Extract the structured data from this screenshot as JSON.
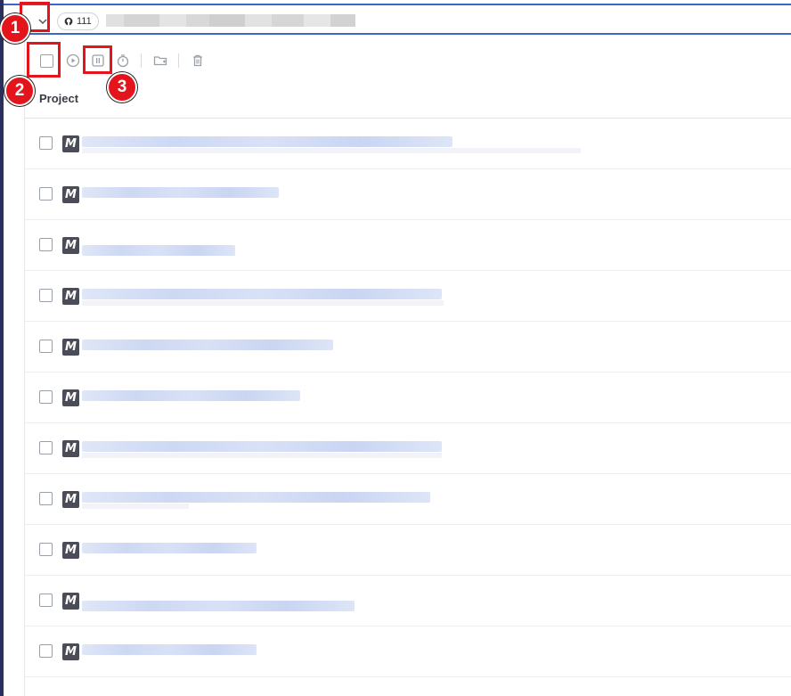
{
  "header": {
    "repo_count": "111",
    "title_obscured": ""
  },
  "toolbar": {
    "icons": [
      "select-all-checkbox",
      "play-icon",
      "pause-icon",
      "timer-icon",
      "move-folder-icon",
      "trash-icon"
    ]
  },
  "table": {
    "column_header": "Project",
    "rows": [
      {
        "icon_letter": "M",
        "name": ""
      },
      {
        "icon_letter": "M",
        "name": ""
      },
      {
        "icon_letter": "M",
        "name": ""
      },
      {
        "icon_letter": "M",
        "name": ""
      },
      {
        "icon_letter": "M",
        "name": ""
      },
      {
        "icon_letter": "M",
        "name": ""
      },
      {
        "icon_letter": "M",
        "name": ""
      },
      {
        "icon_letter": "M",
        "name": ""
      },
      {
        "icon_letter": "M",
        "name": ""
      },
      {
        "icon_letter": "M",
        "name": ""
      },
      {
        "icon_letter": "M",
        "name": ""
      }
    ]
  },
  "annotations": {
    "badge_1": "1",
    "badge_2": "2",
    "badge_3": "3",
    "color": "#e3141b"
  },
  "colors": {
    "accent": "#3a67c9",
    "rail": "#2b2f5c",
    "icon_bg": "#4a4c57"
  }
}
